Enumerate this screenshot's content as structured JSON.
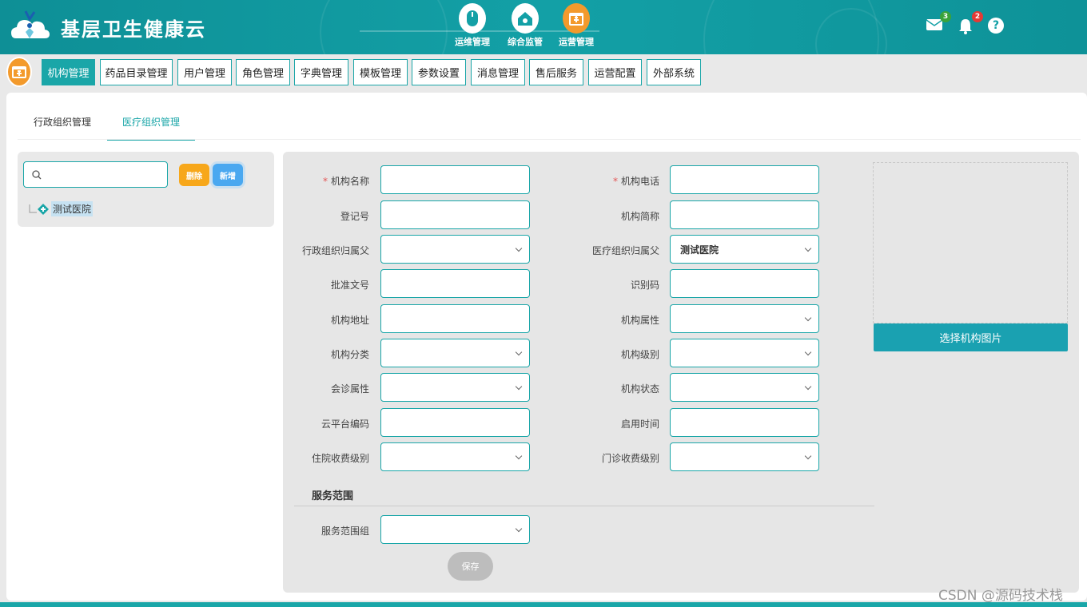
{
  "header": {
    "app_title": "基层卫生健康云",
    "modules": [
      {
        "label": "运维管理",
        "icon": "mouse-icon"
      },
      {
        "label": "综合监管",
        "icon": "home-monitor-icon"
      },
      {
        "label": "运营管理",
        "icon": "calendar-icon",
        "active": true
      }
    ],
    "mail_count": "3",
    "notification_count": "2",
    "help_label": "?"
  },
  "menu": {
    "items": [
      {
        "label": "机构管理",
        "active": true
      },
      {
        "label": "药品目录管理"
      },
      {
        "label": "用户管理"
      },
      {
        "label": "角色管理"
      },
      {
        "label": "字典管理"
      },
      {
        "label": "模板管理"
      },
      {
        "label": "参数设置"
      },
      {
        "label": "消息管理"
      },
      {
        "label": "售后服务"
      },
      {
        "label": "运营配置"
      },
      {
        "label": "外部系统"
      }
    ]
  },
  "tabs": [
    {
      "label": "行政组织管理"
    },
    {
      "label": "医疗组织管理",
      "active": true
    }
  ],
  "tree": {
    "search_placeholder": "",
    "delete_label": "删除",
    "add_label": "新增",
    "nodes": [
      {
        "label": "测试医院"
      }
    ]
  },
  "form": {
    "left_fields": [
      {
        "label": "机构名称",
        "required": true,
        "type": "text",
        "value": ""
      },
      {
        "label": "登记号",
        "type": "text",
        "value": ""
      },
      {
        "label": "行政组织归属父",
        "type": "select",
        "value": ""
      },
      {
        "label": "批准文号",
        "type": "text",
        "value": ""
      },
      {
        "label": "机构地址",
        "type": "text",
        "value": ""
      },
      {
        "label": "机构分类",
        "type": "select",
        "value": ""
      },
      {
        "label": "会诊属性",
        "type": "select",
        "value": ""
      },
      {
        "label": "云平台编码",
        "type": "text",
        "value": ""
      },
      {
        "label": "住院收费级别",
        "type": "select",
        "value": ""
      }
    ],
    "right_fields": [
      {
        "label": "机构电话",
        "required": true,
        "type": "text",
        "value": ""
      },
      {
        "label": "机构简称",
        "type": "text",
        "value": ""
      },
      {
        "label": "医疗组织归属父",
        "type": "select",
        "value": "测试医院"
      },
      {
        "label": "识别码",
        "type": "text",
        "value": ""
      },
      {
        "label": "机构属性",
        "type": "select",
        "value": ""
      },
      {
        "label": "机构级别",
        "type": "select",
        "value": ""
      },
      {
        "label": "机构状态",
        "type": "select",
        "value": ""
      },
      {
        "label": "启用时间",
        "type": "text",
        "value": ""
      },
      {
        "label": "门诊收费级别",
        "type": "select",
        "value": ""
      }
    ],
    "required_mark": "*",
    "section_title": "服务范围",
    "service_field": {
      "label": "服务范围组",
      "type": "select",
      "value": ""
    },
    "save_label": "保存",
    "choose_image_label": "选择机构图片"
  },
  "watermark": "CSDN @源码技术栈",
  "colors": {
    "primary": "#1aa6a8",
    "header": "#13a0a6",
    "accent_orange": "#f39a2c",
    "delete": "#f7a71a",
    "add": "#4aa8f0"
  }
}
